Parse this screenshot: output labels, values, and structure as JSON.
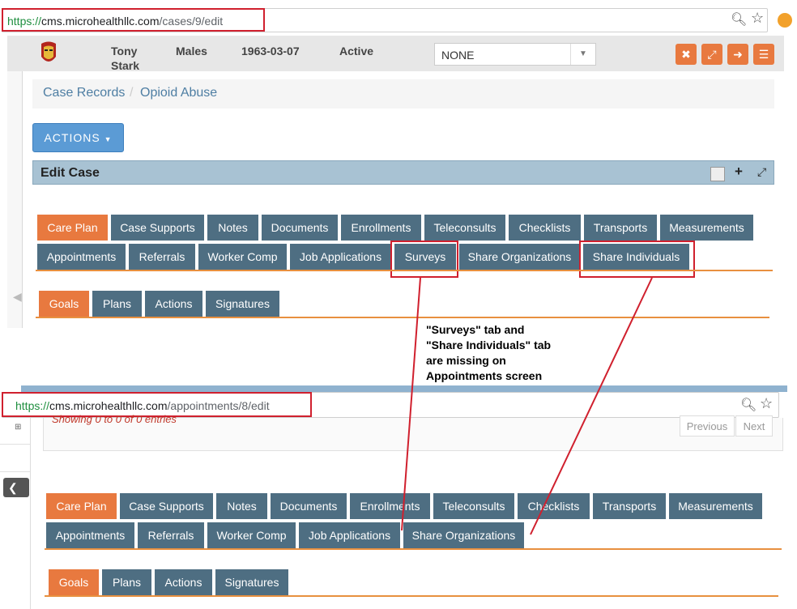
{
  "top_screenshot": {
    "url": {
      "scheme": "https://",
      "host": "cms.microhealthllc.com",
      "path": "/cases/9/edit"
    },
    "patient": {
      "first_name": "Tony",
      "last_name": "Stark",
      "gender": "Males",
      "dob": "1963-03-07",
      "status": "Active"
    },
    "program_select": "NONE",
    "breadcrumb": [
      "Case Records",
      "Opioid Abuse"
    ],
    "actions_button": "ACTIONS",
    "panel_title": "Edit Case",
    "tabs_row1": [
      "Care Plan",
      "Case Supports",
      "Notes",
      "Documents",
      "Enrollments",
      "Teleconsults",
      "Checklists",
      "Transports",
      "Measurements"
    ],
    "tabs_row2": [
      "Appointments",
      "Referrals",
      "Worker Comp",
      "Job Applications",
      "Surveys",
      "Share Organizations",
      "Share Individuals"
    ],
    "subtabs": [
      "Goals",
      "Plans",
      "Actions",
      "Signatures"
    ]
  },
  "annotation": {
    "line1": "\"Surveys\" tab and",
    "line2": "\"Share Individuals\" tab",
    "line3": "are missing on",
    "line4": "Appointments screen",
    "color": "#d0202e"
  },
  "bottom_screenshot": {
    "url": {
      "scheme": "https://",
      "host": "cms.microhealthllc.com",
      "path": "/appointments/8/edit"
    },
    "showing_text": "Showing 0 to 0 of 0 entries",
    "pager": {
      "previous": "Previous",
      "next": "Next"
    },
    "tabs_row1": [
      "Care Plan",
      "Case Supports",
      "Notes",
      "Documents",
      "Enrollments",
      "Teleconsults",
      "Checklists",
      "Transports",
      "Measurements"
    ],
    "tabs_row2": [
      "Appointments",
      "Referrals",
      "Worker Comp",
      "Job Applications",
      "Share Organizations"
    ],
    "subtabs": [
      "Goals",
      "Plans",
      "Actions",
      "Signatures"
    ]
  },
  "colors": {
    "tab": "#4e6e82",
    "active_tab": "#e8793f",
    "accent": "#e8903f",
    "highlight": "#d0202e",
    "actions_button": "#5b9bd5"
  }
}
